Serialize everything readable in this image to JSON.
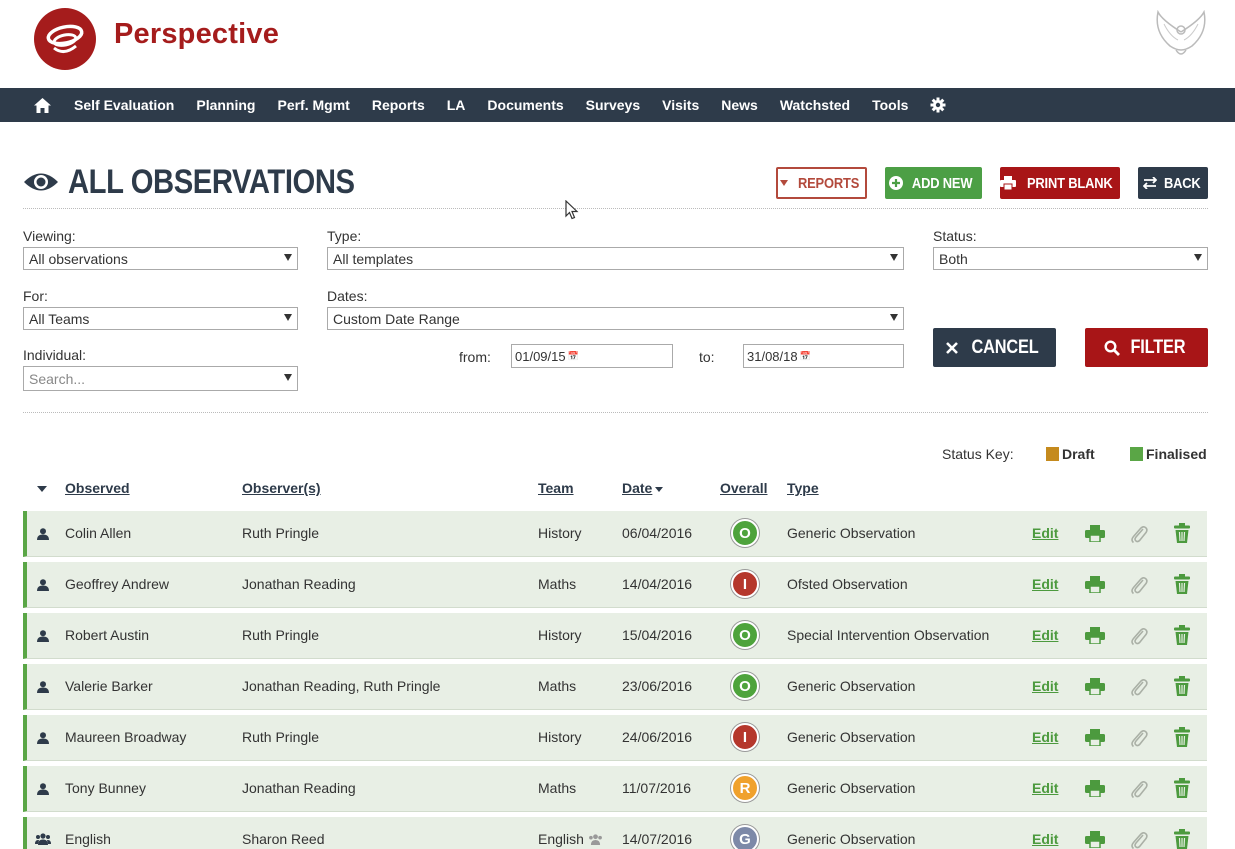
{
  "app": {
    "brand": "Perspective"
  },
  "nav": {
    "items": [
      "Self Evaluation",
      "Planning",
      "Perf. Mgmt",
      "Reports",
      "LA",
      "Documents",
      "Surveys",
      "Visits",
      "News",
      "Watchsted",
      "Tools"
    ]
  },
  "page": {
    "title": "ALL OBSERVATIONS",
    "buttons": {
      "reports": "REPORTS",
      "add_new": "ADD NEW",
      "print_blank": "PRINT BLANK",
      "back": "BACK"
    }
  },
  "filters": {
    "viewing": {
      "label": "Viewing:",
      "value": "All observations"
    },
    "type": {
      "label": "Type:",
      "value": "All templates"
    },
    "status": {
      "label": "Status:",
      "value": "Both"
    },
    "for": {
      "label": "For:",
      "value": "All Teams"
    },
    "dates": {
      "label": "Dates:",
      "value": "Custom Date Range"
    },
    "individual": {
      "label": "Individual:",
      "placeholder": "Search..."
    },
    "from": {
      "label": "from:",
      "value": "01/09/15"
    },
    "to": {
      "label": "to:",
      "value": "31/08/18"
    },
    "cancel_label": "CANCEL",
    "filter_label": "FILTER"
  },
  "status_key": {
    "label": "Status Key:",
    "draft": {
      "label": "Draft",
      "color": "#c58a1d"
    },
    "finalised": {
      "label": "Finalised",
      "color": "#5aa646"
    }
  },
  "table": {
    "columns": {
      "observed": "Observed",
      "observers": "Observer(s)",
      "team": "Team",
      "date": "Date",
      "overall": "Overall",
      "type": "Type"
    },
    "edit_label": "Edit",
    "rows": [
      {
        "observed": "Colin Allen",
        "observers": "Ruth Pringle",
        "team": "History",
        "date": "06/04/2016",
        "overall": "O",
        "type": "Generic Observation",
        "kind": "person"
      },
      {
        "observed": "Geoffrey Andrew",
        "observers": "Jonathan Reading",
        "team": "Maths",
        "date": "14/04/2016",
        "overall": "I",
        "type": "Ofsted Observation",
        "kind": "person"
      },
      {
        "observed": "Robert Austin",
        "observers": "Ruth Pringle",
        "team": "History",
        "date": "15/04/2016",
        "overall": "O",
        "type": "Special Intervention Observation",
        "kind": "person"
      },
      {
        "observed": "Valerie Barker",
        "observers": "Jonathan Reading, Ruth Pringle",
        "team": "Maths",
        "date": "23/06/2016",
        "overall": "O",
        "type": "Generic Observation",
        "kind": "person"
      },
      {
        "observed": "Maureen Broadway",
        "observers": "Ruth Pringle",
        "team": "History",
        "date": "24/06/2016",
        "overall": "I",
        "type": "Generic Observation",
        "kind": "person"
      },
      {
        "observed": "Tony Bunney",
        "observers": "Jonathan Reading",
        "team": "Maths",
        "date": "11/07/2016",
        "overall": "R",
        "type": "Generic Observation",
        "kind": "person"
      },
      {
        "observed": "English",
        "observers": "Sharon Reed",
        "team": "English",
        "date": "14/07/2016",
        "overall": "G",
        "type": "Generic Observation",
        "kind": "team"
      }
    ]
  }
}
